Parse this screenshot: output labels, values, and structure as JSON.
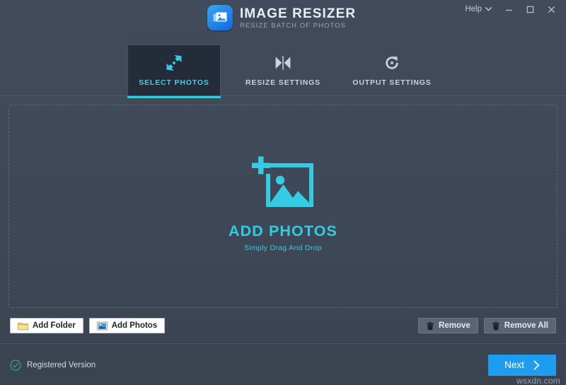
{
  "window": {
    "title": "IMAGE RESIZER",
    "subtitle": "RESIZE BATCH OF PHOTOS",
    "logo_icon": "photo-stack-icon",
    "help_label": "Help",
    "help_chevron_icon": "chevron-down-icon",
    "minimize_icon": "minimize-icon",
    "maximize_icon": "maximize-icon",
    "close_icon": "close-icon"
  },
  "colors": {
    "accent_cyan": "#35cbe3",
    "accent_blue": "#1e9cf0",
    "window_bg": "#3e4857",
    "active_tab_bg": "#242c39",
    "registered_green": "#2f9e6f",
    "button_light_bg": "#fdfdfd",
    "button_muted_bg": "#5b6575"
  },
  "tabs": [
    {
      "label": "SELECT PHOTOS",
      "icon": "expand-arrows-icon",
      "active": true
    },
    {
      "label": "RESIZE SETTINGS",
      "icon": "flip-horizontal-icon",
      "active": false
    },
    {
      "label": "OUTPUT SETTINGS",
      "icon": "rotate-clockwise-icon",
      "active": false
    }
  ],
  "dropzone": {
    "icon": "add-photo-icon",
    "title": "ADD PHOTOS",
    "subtitle": "Simply Drag And Drop"
  },
  "actions": {
    "left": [
      {
        "label": "Add Folder",
        "icon": "folder-icon"
      },
      {
        "label": "Add Photos",
        "icon": "photo-icon"
      }
    ],
    "right": [
      {
        "label": "Remove",
        "icon": "trash-icon"
      },
      {
        "label": "Remove All",
        "icon": "trash-icon"
      }
    ]
  },
  "footer": {
    "status_icon": "check-circle-icon",
    "status_label": "Registered Version",
    "next_label": "Next",
    "next_icon": "chevron-right-icon",
    "watermark": "wsxdn.com"
  }
}
